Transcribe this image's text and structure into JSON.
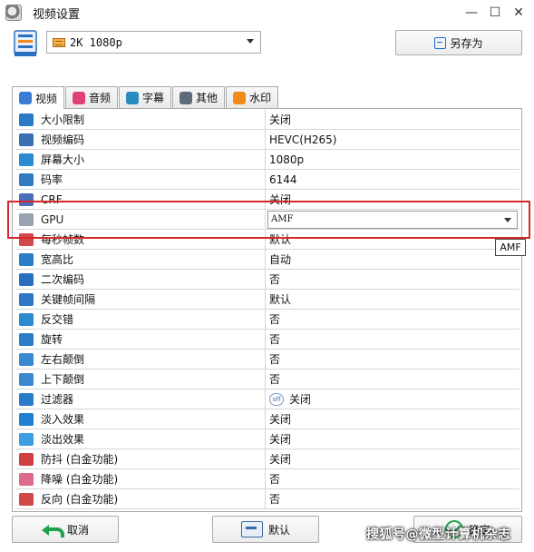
{
  "window": {
    "title": "视频设置"
  },
  "toolbar": {
    "preset_value": "2K 1080p",
    "saveas_label": "另存为"
  },
  "tabs": [
    {
      "label": "视频",
      "icon": "video-icon",
      "color": "#3a7bd5"
    },
    {
      "label": "音频",
      "icon": "music-icon",
      "color": "#e0407a"
    },
    {
      "label": "字幕",
      "icon": "subtitle-icon",
      "color": "#2a8bc0"
    },
    {
      "label": "其他",
      "icon": "tools-icon",
      "color": "#5e6b7a"
    },
    {
      "label": "水印",
      "icon": "watermark-icon",
      "color": "#f08a1c"
    }
  ],
  "properties": [
    {
      "name": "大小限制",
      "value": "关闭",
      "icon": "ruler-icon",
      "color": "#2b78c4"
    },
    {
      "name": "视频编码",
      "value": "HEVC(H265)",
      "icon": "chip-icon",
      "color": "#3a6fb3"
    },
    {
      "name": "屏幕大小",
      "value": "1080p",
      "icon": "monitor-icon",
      "color": "#2a8bd0"
    },
    {
      "name": "码率",
      "value": "6144",
      "icon": "wave-icon",
      "color": "#2f7ac0"
    },
    {
      "name": "CRF",
      "value": "关闭",
      "icon": "atom-icon",
      "color": "#4a6fb8"
    },
    {
      "name": "GPU",
      "value": "AMF",
      "icon": "gpu-icon",
      "color": "#9aa4b0"
    },
    {
      "name": "每秒帧数",
      "value": "默认",
      "icon": "fps-icon",
      "color": "#d04848"
    },
    {
      "name": "宽高比",
      "value": "自动",
      "icon": "aspect-icon",
      "color": "#2a7bc8"
    },
    {
      "name": "二次编码",
      "value": "否",
      "icon": "two-pass-icon",
      "color": "#2a6fc0"
    },
    {
      "name": "关键帧间隔",
      "value": "默认",
      "icon": "keyframe-icon",
      "color": "#2f78c8"
    },
    {
      "name": "反交错",
      "value": "否",
      "icon": "deinterlace-icon",
      "color": "#2a8bd0"
    },
    {
      "name": "旋转",
      "value": "否",
      "icon": "rotate-icon",
      "color": "#2a7bc8"
    },
    {
      "name": "左右颠倒",
      "value": "否",
      "icon": "flip-h-icon",
      "color": "#3a88d0"
    },
    {
      "name": "上下颠倒",
      "value": "否",
      "icon": "flip-v-icon",
      "color": "#3a88d0"
    },
    {
      "name": "过滤器",
      "value": "关闭",
      "icon": "filter-icon",
      "color": "#2a7bc8",
      "toggle": "off"
    },
    {
      "name": "淡入效果",
      "value": "关闭",
      "icon": "fade-in-icon",
      "color": "#1f7fd0"
    },
    {
      "name": "淡出效果",
      "value": "关闭",
      "icon": "fade-out-icon",
      "color": "#3a9ee0"
    },
    {
      "name": "防抖 (白金功能)",
      "value": "关闭",
      "icon": "stabilize-icon",
      "color": "#d04040"
    },
    {
      "name": "降噪 (白金功能)",
      "value": "否",
      "icon": "denoise-icon",
      "color": "#e06a8a"
    },
    {
      "name": "反向 (白金功能)",
      "value": "否",
      "icon": "reverse-icon",
      "color": "#d04848"
    }
  ],
  "tooltip": "AMF",
  "buttons": {
    "cancel": "取消",
    "default": "默认",
    "ok": "确定"
  },
  "watermark_text": "搜狐号@微型计算机杂志"
}
